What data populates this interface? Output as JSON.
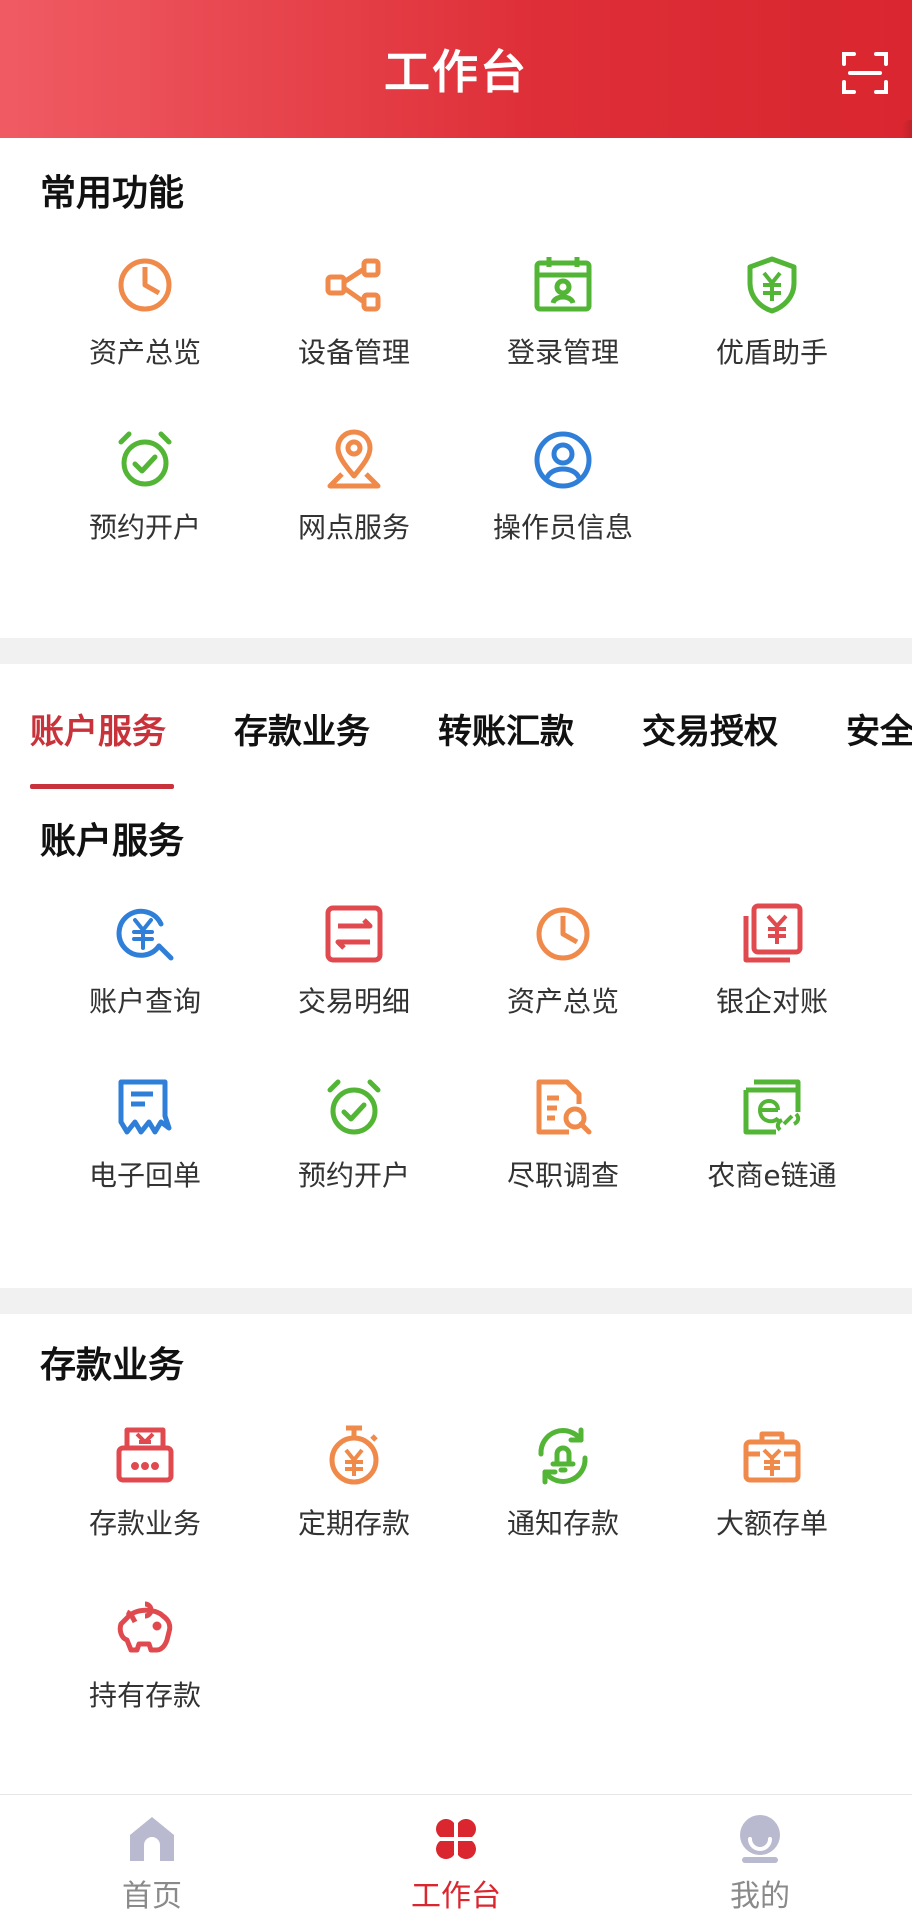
{
  "header": {
    "title": "工作台",
    "scan_icon": "scan-icon"
  },
  "common": {
    "title": "常用功能",
    "items": [
      {
        "label": "资产总览",
        "icon": "pie-chart-icon",
        "color": "#f08a4b"
      },
      {
        "label": "设备管理",
        "icon": "share-nodes-icon",
        "color": "#f08a4b"
      },
      {
        "label": "登录管理",
        "icon": "calendar-user-icon",
        "color": "#52b536"
      },
      {
        "label": "优盾助手",
        "icon": "shield-yuan-icon",
        "color": "#52b536"
      },
      {
        "label": "预约开户",
        "icon": "alarm-clock-icon",
        "color": "#52b536"
      },
      {
        "label": "网点服务",
        "icon": "location-pin-icon",
        "color": "#f08a4b"
      },
      {
        "label": "操作员信息",
        "icon": "user-circle-icon",
        "color": "#2f7fd9"
      }
    ]
  },
  "tabs": {
    "items": [
      "账户服务",
      "存款业务",
      "转账汇款",
      "交易授权",
      "安全"
    ],
    "active_index": 0
  },
  "account": {
    "title": "账户服务",
    "items": [
      {
        "label": "账户查询",
        "icon": "yuan-search-icon",
        "color": "#2f7fd9"
      },
      {
        "label": "交易明细",
        "icon": "transfer-list-icon",
        "color": "#e04a4f"
      },
      {
        "label": "资产总览",
        "icon": "pie-chart-icon",
        "color": "#f08a4b"
      },
      {
        "label": "银企对账",
        "icon": "yuan-cards-icon",
        "color": "#e04a4f"
      },
      {
        "label": "电子回单",
        "icon": "receipt-icon",
        "color": "#2f7fd9"
      },
      {
        "label": "预约开户",
        "icon": "alarm-clock-icon",
        "color": "#52b536"
      },
      {
        "label": "尽职调查",
        "icon": "document-search-icon",
        "color": "#f08a4b"
      },
      {
        "label": "农商e链通",
        "icon": "e-chain-icon",
        "color": "#52b536"
      }
    ]
  },
  "deposit": {
    "title": "存款业务",
    "items": [
      {
        "label": "存款业务",
        "icon": "deposit-box-icon",
        "color": "#e04a4f"
      },
      {
        "label": "定期存款",
        "icon": "stopwatch-yuan-icon",
        "color": "#f08a4b"
      },
      {
        "label": "通知存款",
        "icon": "bell-refresh-icon",
        "color": "#52b536"
      },
      {
        "label": "大额存单",
        "icon": "bag-yuan-icon",
        "color": "#f08a4b"
      },
      {
        "label": "持有存款",
        "icon": "piggy-bank-icon",
        "color": "#e04a4f"
      }
    ]
  },
  "bottom_nav": {
    "items": [
      {
        "label": "首页",
        "icon": "home-icon"
      },
      {
        "label": "工作台",
        "icon": "clover-icon"
      },
      {
        "label": "我的",
        "icon": "profile-icon"
      }
    ],
    "active_index": 1,
    "active_color": "#d9262f",
    "inactive_color": "#8a8a8a"
  }
}
